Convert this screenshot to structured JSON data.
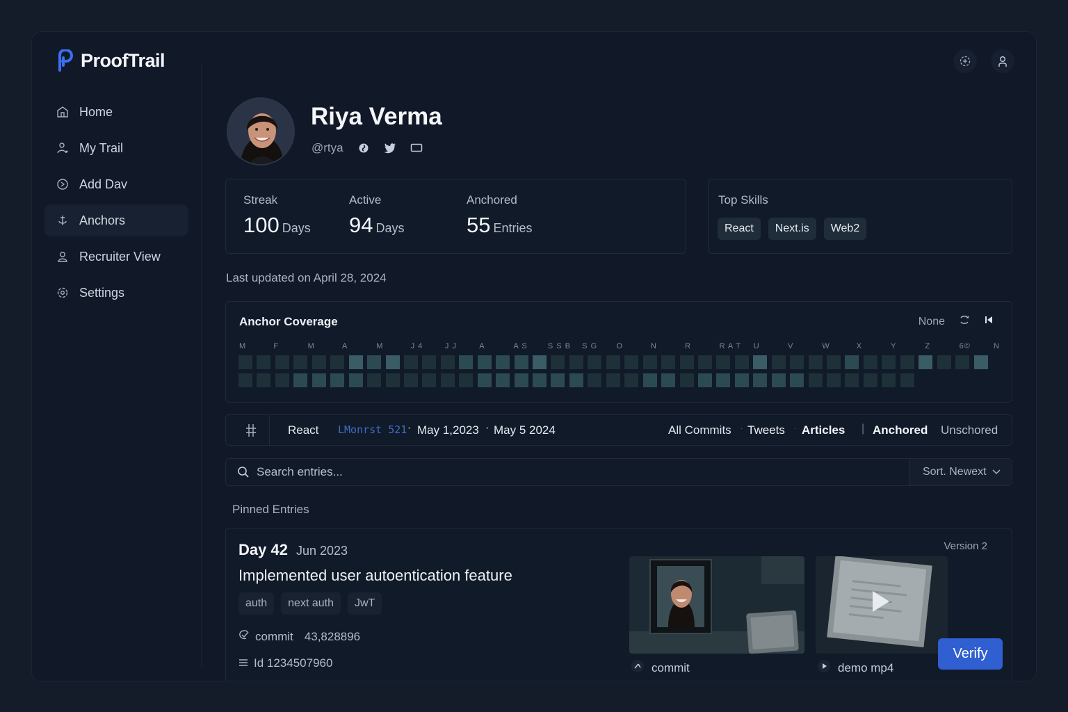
{
  "app": {
    "name": "ProofTrail"
  },
  "sidebar": {
    "items": [
      {
        "label": "Home",
        "icon": "home-icon"
      },
      {
        "label": "My Trail",
        "icon": "trail-icon"
      },
      {
        "label": "Add Dav",
        "icon": "add-day-icon"
      },
      {
        "label": "Anchors",
        "icon": "anchor-icon",
        "active": true
      },
      {
        "label": "Recruiter View",
        "icon": "recruiter-icon"
      },
      {
        "label": "Settings",
        "icon": "gear-icon"
      }
    ]
  },
  "header": {
    "icons": [
      "settings-badge-icon",
      "user-icon"
    ]
  },
  "profile": {
    "name": "Riya Verma",
    "handle": "@rtya",
    "social_icons": [
      "github-icon",
      "twitter-icon",
      "display-icon"
    ]
  },
  "stats": [
    {
      "label": "Streak",
      "value": "100",
      "unit": "Days"
    },
    {
      "label": "Active",
      "value": "94",
      "unit": "Days"
    },
    {
      "label": "Anchored",
      "value": "55",
      "unit": "Entries"
    }
  ],
  "skills": {
    "title": "Top Skills",
    "items": [
      "React",
      "Next.is",
      "Web2"
    ]
  },
  "last_updated": "Last updated on April 28, 2024",
  "coverage": {
    "title": "Anchor Coverage",
    "range_label": "None",
    "months": [
      "M",
      "F",
      "M",
      "A",
      "M",
      "J 4",
      "J J",
      "A",
      "A S",
      "S S B",
      "S G",
      "O",
      "N",
      "R",
      "R A T",
      "U",
      "V",
      "W",
      "X",
      "Y",
      "Z",
      "6©",
      "N"
    ],
    "row1_levels": [
      0,
      0,
      0,
      0,
      0,
      0,
      2,
      1,
      2,
      0,
      0,
      0,
      1,
      1,
      1,
      1,
      2,
      0,
      0,
      0,
      0,
      0,
      0,
      0,
      0,
      0,
      0,
      0,
      2,
      0,
      0,
      0,
      0,
      1,
      0,
      0,
      0,
      2,
      0,
      0,
      2
    ],
    "row2_levels": [
      0,
      0,
      0,
      1,
      1,
      1,
      1,
      0,
      0,
      0,
      0,
      0,
      0,
      1,
      1,
      1,
      1,
      1,
      1,
      0,
      0,
      0,
      1,
      1,
      0,
      1,
      1,
      1,
      1,
      1,
      1,
      0,
      0,
      0,
      0,
      0,
      0
    ]
  },
  "filters": {
    "topic": "React",
    "range_tag": "LMonrst 521",
    "date_from": "May 1,2023",
    "date_to": "May 5 2024",
    "types": [
      "All Commits",
      "Tweets",
      "Articles"
    ],
    "status": [
      "Anchored",
      "Unschored"
    ]
  },
  "search": {
    "placeholder": "Search entries...",
    "sort_label": "Sort. Newext"
  },
  "pinned": {
    "label": "Pinned Entries",
    "entry": {
      "day": "Day 42",
      "date": "Jun 2023",
      "title": "Implemented user autoentication feature",
      "tags": [
        "auth",
        "next auth",
        "JwT"
      ],
      "commit_label": "commit",
      "commit_value": "43,828896",
      "id_label": "Id 1234507960",
      "version": "Version 2",
      "attachments": [
        {
          "caption": "commit",
          "icon": "commit-icon"
        },
        {
          "caption": "demo mp4",
          "icon": "play-icon"
        }
      ],
      "verify_label": "Verify"
    }
  },
  "colors": {
    "accent": "#2f5fd0",
    "background": "#111827",
    "cell_low": "#1e3038",
    "cell_mid": "#2c4a52",
    "cell_high": "#3a5c64"
  }
}
